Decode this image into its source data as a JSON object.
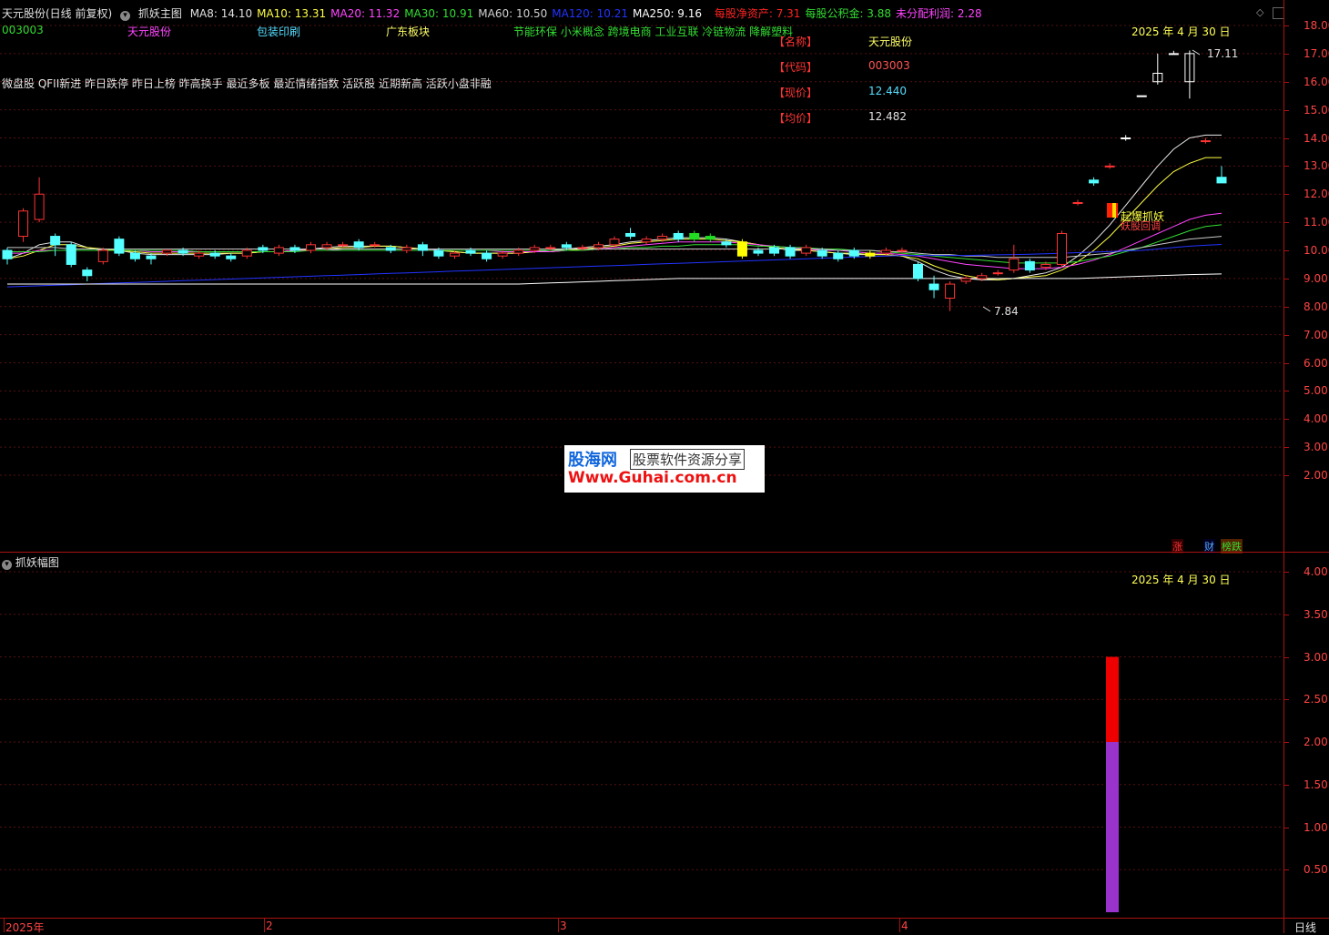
{
  "header": {
    "stock_title": "天元股份(日线 前复权)",
    "indicator_name": "抓妖主图",
    "ma": [
      {
        "label": "MA8: 14.10",
        "color": "#e0e0e0"
      },
      {
        "label": "MA10: 13.31",
        "color": "#ffff44"
      },
      {
        "label": "MA20: 11.32",
        "color": "#ff44ff"
      },
      {
        "label": "MA30: 10.91",
        "color": "#33dd33"
      },
      {
        "label": "MA60: 10.50",
        "color": "#d0d0d0"
      },
      {
        "label": "MA120: 10.21",
        "color": "#2233ff"
      },
      {
        "label": "MA250: 9.16",
        "color": "#ffffff"
      }
    ],
    "fundamentals": [
      {
        "label": "每股净资产: 7.31",
        "color": "#ff2222"
      },
      {
        "label": "每股公积金: 3.88",
        "color": "#33dd33"
      },
      {
        "label": "未分配利润: 2.28",
        "color": "#ff44ff"
      }
    ]
  },
  "row2": {
    "code": "003003",
    "name": "天元股份",
    "industry": "包装印刷",
    "region": "广东板块",
    "concepts": "节能环保 小米概念 跨境电商 工业互联 冷链物流 降解塑料"
  },
  "tags_line": "微盘股 QFII新进 昨日跌停 昨日上榜 昨高换手 最近多板 最近情绪指数 活跃股 近期新高 活跃小盘非融",
  "info_panel": [
    {
      "label": "【名称】",
      "value": "天元股份",
      "color": "#ffff66"
    },
    {
      "label": "【代码】",
      "value": "003003",
      "color": "#ff5555"
    },
    {
      "label": "【现价】",
      "value": "12.440",
      "color": "#55ddff"
    },
    {
      "label": "【均价】",
      "value": "12.482",
      "color": "#e0e0e0"
    }
  ],
  "date_main": "2025 年 4 月 30 日",
  "date_sub": "2025 年 4 月 30 日",
  "annotations": {
    "high": "17.11",
    "low": "7.84",
    "signal1": "起爆抓妖",
    "signal2": "妖股回调"
  },
  "bottom_icons": [
    "涨",
    "财",
    "榜跌"
  ],
  "sub_panel_title": "抓妖幅图",
  "x_labels": [
    "2025年",
    "2",
    "3",
    "4"
  ],
  "period_label": "日线",
  "watermark": {
    "line1": "股海网",
    "line2": "股票软件资源分享",
    "line3": "Www.Guhai.com.cn"
  },
  "chart_data": [
    {
      "type": "candlestick",
      "y_ticks": [
        "18.00",
        "17.00",
        "16.00",
        "15.00",
        "14.00",
        "13.00",
        "12.00",
        "11.00",
        "10.00",
        "9.00",
        "8.00",
        "7.00",
        "6.00",
        "5.00",
        "4.00",
        "3.00",
        "2.00"
      ],
      "ylim": [
        1.0,
        18.5
      ],
      "candles": [
        [
          10.0,
          9.7,
          10.1,
          9.5
        ],
        [
          10.5,
          11.4,
          11.5,
          10.3
        ],
        [
          11.1,
          12.0,
          12.6,
          11.0
        ],
        [
          10.5,
          10.2,
          10.6,
          9.8
        ],
        [
          10.2,
          9.5,
          10.3,
          9.4
        ],
        [
          9.3,
          9.1,
          9.4,
          8.9
        ],
        [
          9.6,
          10.0,
          10.1,
          9.5
        ],
        [
          10.4,
          9.9,
          10.5,
          9.8
        ],
        [
          9.9,
          9.7,
          10.0,
          9.6
        ],
        [
          9.8,
          9.7,
          9.9,
          9.5
        ],
        [
          9.9,
          10.0,
          10.0,
          9.8
        ],
        [
          10.0,
          9.9,
          10.1,
          9.8
        ],
        [
          9.8,
          9.9,
          10.0,
          9.7
        ],
        [
          9.9,
          9.8,
          10.0,
          9.7
        ],
        [
          9.8,
          9.7,
          9.9,
          9.6
        ],
        [
          9.8,
          10.0,
          10.1,
          9.7
        ],
        [
          10.1,
          10.0,
          10.2,
          9.9
        ],
        [
          9.9,
          10.1,
          10.2,
          9.8
        ],
        [
          10.1,
          10.0,
          10.2,
          9.9
        ],
        [
          10.0,
          10.2,
          10.3,
          9.9
        ],
        [
          10.1,
          10.2,
          10.3,
          10.0
        ],
        [
          10.2,
          10.2,
          10.3,
          10.1
        ],
        [
          10.3,
          10.1,
          10.4,
          10.0
        ],
        [
          10.2,
          10.2,
          10.3,
          10.1
        ],
        [
          10.1,
          10.0,
          10.2,
          9.9
        ],
        [
          10.0,
          10.1,
          10.2,
          9.9
        ],
        [
          10.2,
          10.0,
          10.3,
          9.8
        ],
        [
          10.0,
          9.8,
          10.1,
          9.7
        ],
        [
          9.8,
          9.9,
          10.0,
          9.7
        ],
        [
          10.0,
          9.9,
          10.1,
          9.8
        ],
        [
          9.9,
          9.7,
          10.0,
          9.6
        ],
        [
          9.8,
          9.9,
          10.0,
          9.7
        ],
        [
          9.9,
          10.0,
          10.1,
          9.8
        ],
        [
          10.0,
          10.1,
          10.2,
          9.9
        ],
        [
          10.1,
          10.1,
          10.2,
          10.0
        ],
        [
          10.2,
          10.1,
          10.3,
          10.0
        ],
        [
          10.1,
          10.1,
          10.2,
          10.0
        ],
        [
          10.1,
          10.2,
          10.3,
          10.0
        ],
        [
          10.2,
          10.4,
          10.5,
          10.1
        ],
        [
          10.6,
          10.5,
          10.8,
          10.4
        ],
        [
          10.3,
          10.4,
          10.5,
          10.2
        ],
        [
          10.4,
          10.5,
          10.6,
          10.3
        ],
        [
          10.6,
          10.4,
          10.7,
          10.3
        ],
        [
          10.4,
          10.6,
          10.7,
          10.3
        ],
        [
          10.5,
          10.4,
          10.6,
          10.3
        ],
        [
          10.3,
          10.2,
          10.4,
          10.1
        ],
        [
          10.3,
          9.8,
          10.4,
          9.7
        ],
        [
          10.0,
          9.9,
          10.1,
          9.8
        ],
        [
          10.1,
          9.9,
          10.2,
          9.8
        ],
        [
          10.1,
          9.8,
          10.2,
          9.7
        ],
        [
          9.9,
          10.1,
          10.2,
          9.8
        ],
        [
          10.0,
          9.8,
          10.1,
          9.7
        ],
        [
          9.9,
          9.7,
          10.0,
          9.6
        ],
        [
          10.0,
          9.8,
          10.1,
          9.7
        ],
        [
          9.8,
          9.9,
          10.0,
          9.7
        ],
        [
          9.9,
          10.0,
          10.1,
          9.8
        ],
        [
          10.0,
          10.0,
          10.1,
          9.9
        ],
        [
          9.5,
          9.0,
          9.6,
          8.9
        ],
        [
          8.8,
          8.6,
          9.1,
          8.3
        ],
        [
          8.3,
          8.8,
          8.9,
          7.84
        ],
        [
          8.9,
          9.0,
          9.1,
          8.8
        ],
        [
          9.0,
          9.1,
          9.2,
          8.9
        ],
        [
          9.2,
          9.2,
          9.3,
          9.1
        ],
        [
          9.3,
          9.7,
          10.2,
          9.2
        ],
        [
          9.6,
          9.3,
          9.7,
          9.2
        ],
        [
          9.4,
          9.5,
          9.6,
          9.3
        ],
        [
          9.5,
          10.6,
          10.7,
          9.4
        ],
        [
          11.7,
          11.7,
          11.8,
          11.6
        ],
        [
          12.5,
          12.4,
          12.6,
          12.3
        ],
        [
          13.0,
          13.0,
          13.1,
          12.9
        ],
        [
          14.0,
          14.0,
          14.1,
          13.9
        ],
        [
          15.5,
          15.5,
          15.5,
          15.5
        ],
        [
          16.0,
          16.3,
          17.0,
          15.9
        ],
        [
          17.0,
          17.0,
          17.1,
          17.0
        ],
        [
          17.0,
          16.0,
          17.11,
          15.4
        ],
        [
          13.9,
          13.9,
          14.0,
          13.8
        ],
        [
          12.6,
          12.4,
          13.0,
          12.4
        ]
      ],
      "ma_lines": [
        {
          "name": "MA8",
          "color": "#e8e8e8",
          "values": [
            9.7,
            9.9,
            10.2,
            10.3,
            10.3,
            10.1,
            10.0,
            10.0,
            9.9,
            9.85,
            9.85,
            9.85,
            9.85,
            9.85,
            9.9,
            9.9,
            9.95,
            9.95,
            10.0,
            10.05,
            10.1,
            10.15,
            10.15,
            10.15,
            10.15,
            10.1,
            10.05,
            10.0,
            9.95,
            9.9,
            9.9,
            9.9,
            9.9,
            9.95,
            10.0,
            10.05,
            10.1,
            10.15,
            10.2,
            10.3,
            10.35,
            10.4,
            10.45,
            10.45,
            10.45,
            10.4,
            10.3,
            10.2,
            10.1,
            10.0,
            10.0,
            9.95,
            9.9,
            9.85,
            9.85,
            9.85,
            9.8,
            9.6,
            9.3,
            9.1,
            9.0,
            8.95,
            8.95,
            9.0,
            9.1,
            9.2,
            9.4,
            9.8,
            10.3,
            10.9,
            11.6,
            12.3,
            13.0,
            13.6,
            14.0,
            14.1,
            14.1
          ]
        },
        {
          "name": "MA10",
          "color": "#ffff44",
          "values": [
            9.7,
            9.8,
            10.0,
            10.2,
            10.2,
            10.1,
            10.05,
            10.0,
            9.95,
            9.9,
            9.9,
            9.9,
            9.9,
            9.9,
            9.9,
            9.9,
            9.95,
            9.95,
            10.0,
            10.05,
            10.05,
            10.1,
            10.1,
            10.15,
            10.15,
            10.1,
            10.05,
            10.0,
            9.95,
            9.9,
            9.9,
            9.9,
            9.9,
            9.95,
            9.95,
            10.0,
            10.05,
            10.1,
            10.15,
            10.25,
            10.3,
            10.35,
            10.4,
            10.4,
            10.4,
            10.35,
            10.3,
            10.2,
            10.1,
            10.05,
            10.0,
            9.95,
            9.9,
            9.9,
            9.85,
            9.85,
            9.8,
            9.7,
            9.45,
            9.25,
            9.1,
            9.0,
            8.95,
            9.0,
            9.05,
            9.1,
            9.3,
            9.6,
            10.0,
            10.5,
            11.1,
            11.7,
            12.3,
            12.8,
            13.1,
            13.3,
            13.3
          ]
        },
        {
          "name": "MA20",
          "color": "#ff44ff",
          "values": [
            9.9,
            9.9,
            10.0,
            10.0,
            10.0,
            10.0,
            10.0,
            10.0,
            10.0,
            9.95,
            9.95,
            9.95,
            9.95,
            9.95,
            9.95,
            9.95,
            9.95,
            9.95,
            10.0,
            10.0,
            10.0,
            10.05,
            10.05,
            10.05,
            10.05,
            10.05,
            10.05,
            10.0,
            10.0,
            10.0,
            10.0,
            9.95,
            9.95,
            9.95,
            9.95,
            10.0,
            10.0,
            10.05,
            10.1,
            10.15,
            10.2,
            10.25,
            10.3,
            10.3,
            10.3,
            10.3,
            10.25,
            10.2,
            10.15,
            10.1,
            10.05,
            10.0,
            10.0,
            9.95,
            9.9,
            9.9,
            9.85,
            9.8,
            9.7,
            9.6,
            9.5,
            9.45,
            9.4,
            9.35,
            9.35,
            9.35,
            9.4,
            9.5,
            9.65,
            9.85,
            10.1,
            10.35,
            10.6,
            10.85,
            11.1,
            11.25,
            11.32
          ]
        },
        {
          "name": "MA30",
          "color": "#33dd33",
          "values": [
            9.95,
            9.95,
            9.95,
            10.0,
            10.0,
            10.0,
            10.0,
            10.0,
            10.0,
            10.0,
            10.0,
            10.0,
            9.95,
            9.95,
            9.95,
            9.95,
            9.95,
            9.95,
            9.95,
            10.0,
            10.0,
            10.0,
            10.0,
            10.0,
            10.0,
            10.0,
            10.0,
            10.0,
            10.0,
            10.0,
            10.0,
            10.0,
            10.0,
            10.0,
            10.0,
            10.0,
            10.0,
            10.05,
            10.05,
            10.1,
            10.1,
            10.15,
            10.15,
            10.2,
            10.2,
            10.2,
            10.2,
            10.15,
            10.15,
            10.1,
            10.1,
            10.05,
            10.05,
            10.0,
            10.0,
            9.95,
            9.9,
            9.85,
            9.8,
            9.75,
            9.7,
            9.65,
            9.6,
            9.55,
            9.55,
            9.55,
            9.55,
            9.6,
            9.7,
            9.8,
            9.95,
            10.1,
            10.3,
            10.5,
            10.7,
            10.85,
            10.91
          ]
        },
        {
          "name": "MA60",
          "color": "#c8c8c8",
          "values": [
            10.1,
            10.1,
            10.1,
            10.1,
            10.05,
            10.05,
            10.05,
            10.05,
            10.05,
            10.05,
            10.05,
            10.05,
            10.05,
            10.05,
            10.05,
            10.05,
            10.05,
            10.05,
            10.05,
            10.05,
            10.05,
            10.05,
            10.05,
            10.05,
            10.05,
            10.05,
            10.05,
            10.05,
            10.05,
            10.05,
            10.05,
            10.05,
            10.05,
            10.05,
            10.05,
            10.05,
            10.05,
            10.05,
            10.05,
            10.05,
            10.05,
            10.05,
            10.05,
            10.05,
            10.05,
            10.05,
            10.05,
            10.05,
            10.05,
            10.05,
            10.05,
            10.05,
            10.0,
            10.0,
            10.0,
            9.95,
            9.95,
            9.9,
            9.85,
            9.85,
            9.8,
            9.8,
            9.75,
            9.75,
            9.75,
            9.75,
            9.75,
            9.8,
            9.85,
            9.9,
            10.0,
            10.1,
            10.2,
            10.3,
            10.4,
            10.45,
            10.5
          ]
        },
        {
          "name": "MA120",
          "color": "#2233ff",
          "values": [
            8.7,
            8.72,
            8.74,
            8.76,
            8.78,
            8.8,
            8.82,
            8.84,
            8.86,
            8.88,
            8.9,
            8.92,
            8.94,
            8.96,
            8.98,
            9.0,
            9.02,
            9.04,
            9.06,
            9.08,
            9.1,
            9.12,
            9.14,
            9.16,
            9.18,
            9.2,
            9.22,
            9.24,
            9.26,
            9.28,
            9.3,
            9.32,
            9.34,
            9.36,
            9.38,
            9.4,
            9.42,
            9.44,
            9.46,
            9.48,
            9.5,
            9.52,
            9.54,
            9.56,
            9.58,
            9.6,
            9.62,
            9.64,
            9.66,
            9.68,
            9.7,
            9.72,
            9.74,
            9.76,
            9.78,
            9.8,
            9.82,
            9.82,
            9.82,
            9.82,
            9.82,
            9.83,
            9.84,
            9.85,
            9.86,
            9.88,
            9.9,
            9.92,
            9.94,
            9.96,
            9.98,
            10.0,
            10.05,
            10.1,
            10.15,
            10.18,
            10.21
          ]
        },
        {
          "name": "MA250",
          "color": "#ffffff",
          "values": [
            8.8,
            8.8,
            8.8,
            8.8,
            8.8,
            8.8,
            8.8,
            8.8,
            8.8,
            8.8,
            8.8,
            8.8,
            8.8,
            8.8,
            8.8,
            8.8,
            8.8,
            8.8,
            8.8,
            8.8,
            8.8,
            8.8,
            8.8,
            8.8,
            8.8,
            8.8,
            8.8,
            8.8,
            8.8,
            8.8,
            8.8,
            8.8,
            8.8,
            8.82,
            8.84,
            8.86,
            8.88,
            8.9,
            8.92,
            8.94,
            8.96,
            8.98,
            9.0,
            9.0,
            9.0,
            9.0,
            9.0,
            9.0,
            9.0,
            9.0,
            9.0,
            9.0,
            9.0,
            9.0,
            9.0,
            9.0,
            9.0,
            9.0,
            9.0,
            9.0,
            9.0,
            9.0,
            9.0,
            9.0,
            9.0,
            9.0,
            9.0,
            9.0,
            9.02,
            9.04,
            9.06,
            9.08,
            9.1,
            9.12,
            9.14,
            9.15,
            9.16
          ]
        }
      ]
    },
    {
      "type": "bar",
      "y_ticks": [
        "4.00",
        "3.50",
        "3.00",
        "2.50",
        "2.00",
        "1.50",
        "1.00",
        "0.50"
      ],
      "ylim": [
        0,
        4.3
      ],
      "series": [
        {
          "color": "#9933cc",
          "base": 0,
          "top": 2.0
        },
        {
          "color": "#ee0000",
          "base": 2.0,
          "top": 3.0
        }
      ]
    }
  ]
}
